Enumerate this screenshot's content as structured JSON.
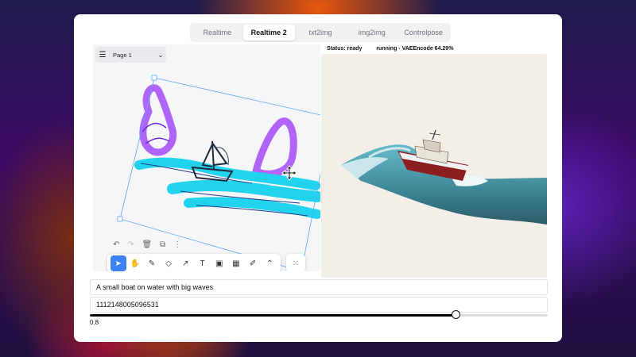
{
  "tabs": [
    {
      "label": "Realtime",
      "active": false
    },
    {
      "label": "Realtime 2",
      "active": true
    },
    {
      "label": "txt2img",
      "active": false
    },
    {
      "label": "img2img",
      "active": false
    },
    {
      "label": "Controlpose",
      "active": false
    }
  ],
  "canvas": {
    "page_label": "Page 1",
    "menu_icon": "hamburger-icon",
    "page_dropdown_icon": "chevron-down-icon"
  },
  "edit_toolbar": [
    "undo-icon",
    "redo-icon",
    "trash-icon",
    "duplicate-icon",
    "more-icon"
  ],
  "tools": [
    {
      "name": "select-tool",
      "icon": "cursor-icon",
      "glyph": "➤",
      "active": true
    },
    {
      "name": "hand-tool",
      "icon": "hand-icon",
      "glyph": "✋",
      "active": false
    },
    {
      "name": "draw-tool",
      "icon": "pencil-icon",
      "glyph": "✎",
      "active": false
    },
    {
      "name": "eraser-tool",
      "icon": "eraser-icon",
      "glyph": "◇",
      "active": false
    },
    {
      "name": "arrow-tool",
      "icon": "arrow-icon",
      "glyph": "↗",
      "active": false
    },
    {
      "name": "text-tool",
      "icon": "text-icon",
      "glyph": "T",
      "active": false
    },
    {
      "name": "note-tool",
      "icon": "note-icon",
      "glyph": "▣",
      "active": false
    },
    {
      "name": "image-tool",
      "icon": "image-icon",
      "glyph": "▦",
      "active": false
    },
    {
      "name": "highlight-tool",
      "icon": "highlighter-icon",
      "glyph": "✐",
      "active": false
    },
    {
      "name": "more-tools",
      "icon": "chevron-up-icon",
      "glyph": "⌃",
      "active": false
    }
  ],
  "status": {
    "state": "Status: ready",
    "progress": "running - VAEEncode 64.29%"
  },
  "prompt": "A small boat on water with big waves",
  "seed": "1112148005096531",
  "strength": {
    "value": "0.8",
    "fraction": 0.8
  },
  "colors": {
    "accent": "#3b82f6",
    "sketch_cyan": "#22d3ee",
    "sketch_purple": "#a855f7",
    "selection": "#60a5fa"
  }
}
